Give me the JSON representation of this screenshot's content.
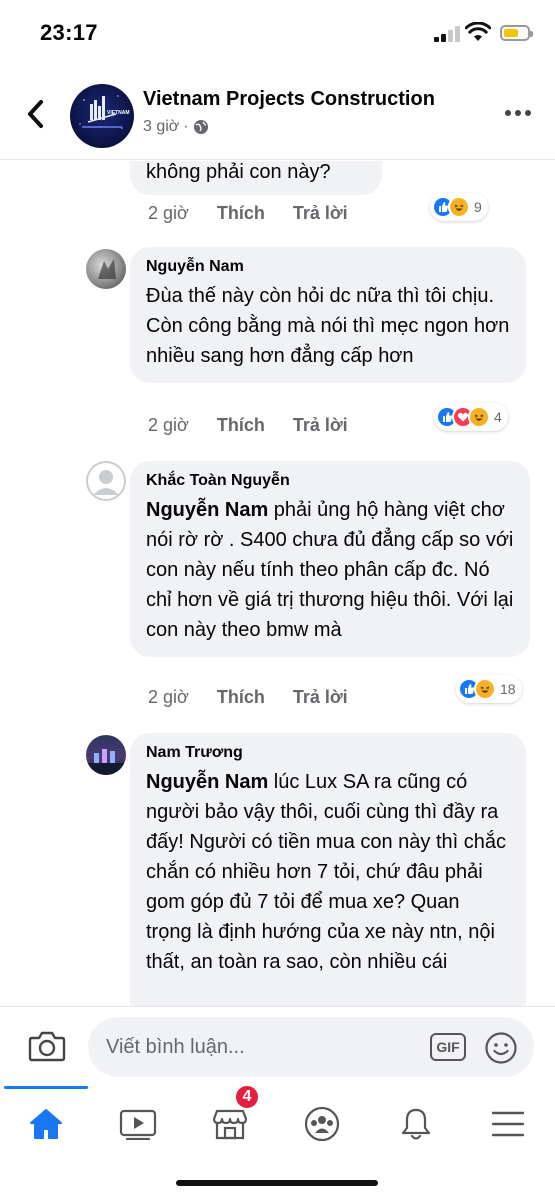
{
  "status_bar": {
    "time": "23:17"
  },
  "header": {
    "page_name": "Vietnam Projects Construction",
    "time_ago": "3 giờ",
    "separator": "·",
    "avatar_text": "VIETNAM"
  },
  "comments": [
    {
      "author": "",
      "mention": "",
      "text": "không phải con này?",
      "time": "2 giờ",
      "like_label": "Thích",
      "reply_label": "Trả lời",
      "reactions": [
        "like",
        "haha"
      ],
      "reaction_count": "9"
    },
    {
      "author": "Nguyễn Nam",
      "mention": "",
      "text": "Đùa thế này còn hỏi dc nữa thì tôi chịu. Còn công bằng mà nói thì mẹc ngon hơn nhiều sang hơn đẳng cấp hơn",
      "time": "2 giờ",
      "like_label": "Thích",
      "reply_label": "Trả lời",
      "reactions": [
        "like",
        "love",
        "haha"
      ],
      "reaction_count": "4"
    },
    {
      "author": "Khắc Toàn Nguyễn",
      "mention": "Nguyễn Nam",
      "text": " phải ủng hộ hàng việt chơ nói rờ rờ . S400 chưa đủ đẳng cấp so với con này nếu tính theo phân cấp đc. Nó chỉ hơn về giá trị thương hiệu thôi. Với lại con này theo bmw mà",
      "time": "2 giờ",
      "like_label": "Thích",
      "reply_label": "Trả lời",
      "reactions": [
        "like",
        "haha"
      ],
      "reaction_count": "18"
    },
    {
      "author": "Nam Trương",
      "mention": "Nguyễn Nam",
      "text": " lúc Lux SA ra cũng có người bảo vậy thôi, cuối cùng thì đầy ra đấy! Người có tiền mua con này thì chắc chắn có nhiều hơn 7 tỏi, chứ đâu phải gom góp đủ 7 tỏi để mua xe? Quan trọng là định hướng của xe này ntn, nội thất, an toàn ra sao, còn nhiều cái",
      "time": "",
      "like_label": "",
      "reply_label": "",
      "reactions": [],
      "reaction_count": ""
    }
  ],
  "composer": {
    "placeholder": "Viết bình luận...",
    "gif_label": "GIF"
  },
  "tab_bar": {
    "tabs": [
      "home",
      "watch",
      "marketplace",
      "groups",
      "notifications",
      "menu"
    ],
    "marketplace_badge": "4"
  },
  "colors": {
    "brand_blue": "#1877f2",
    "bubble_bg": "#f0f2f5",
    "meta_gray": "#65676b",
    "badge_red": "#e41e3f"
  }
}
